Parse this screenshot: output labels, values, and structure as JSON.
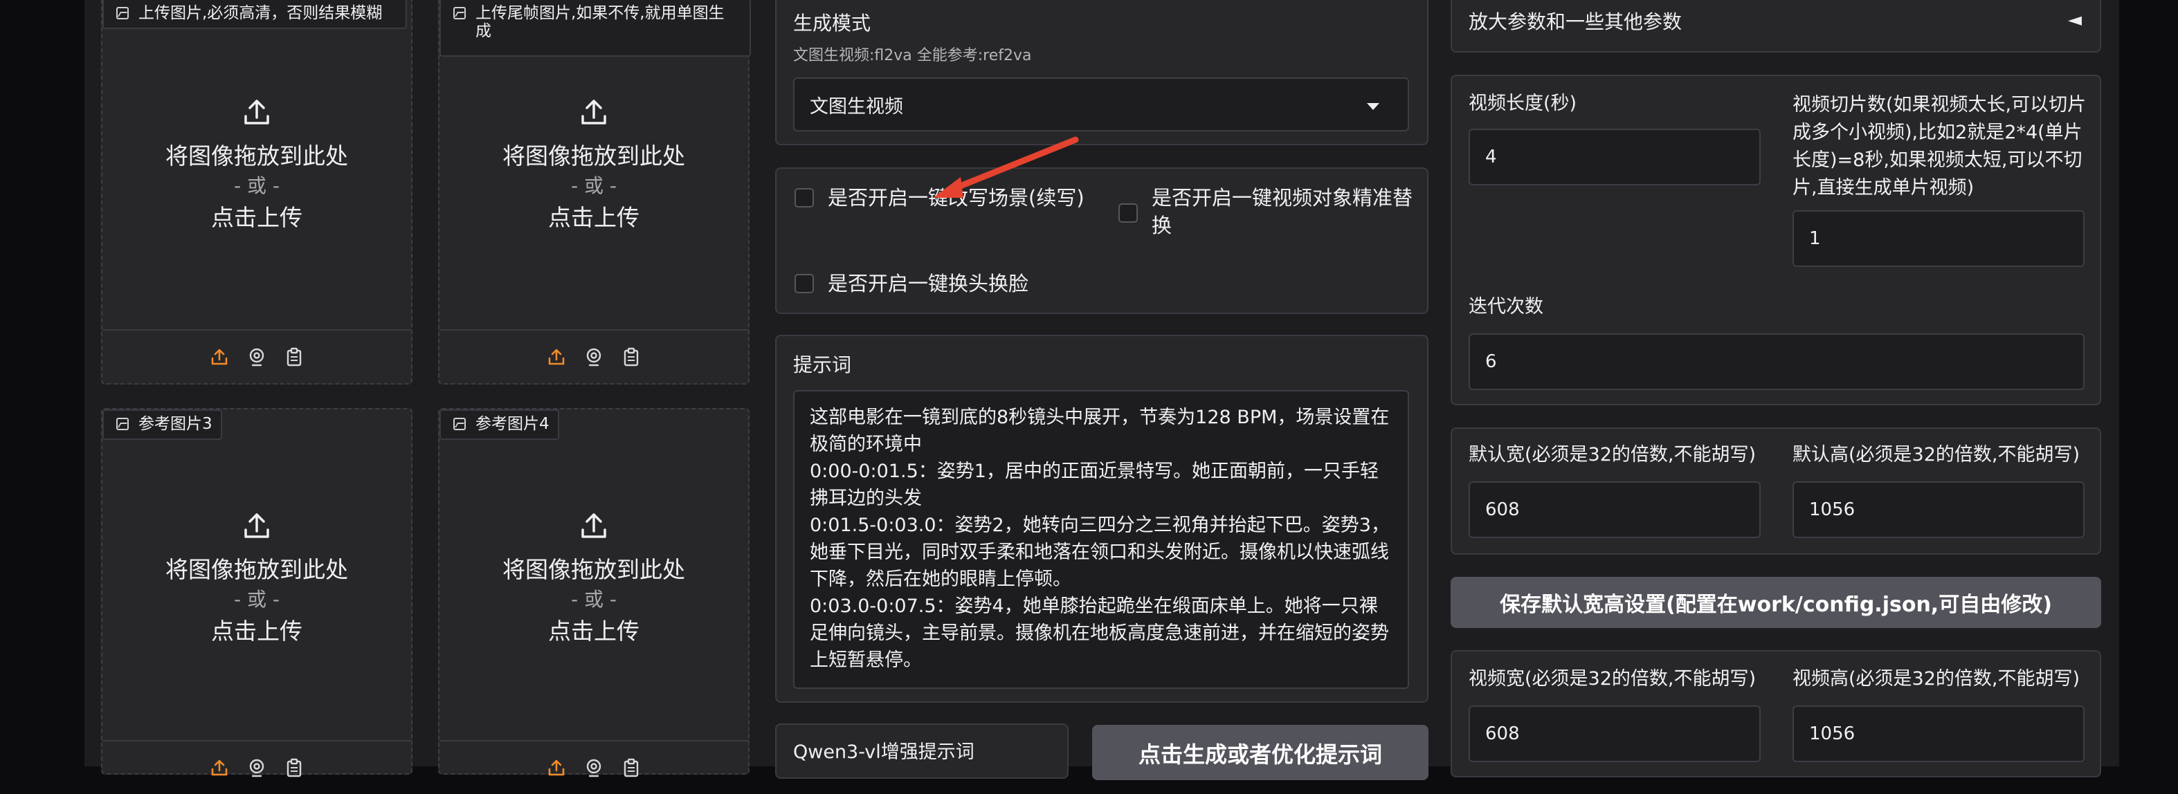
{
  "uploads": [
    {
      "tag": "上传图片,必须高清，否则结果模糊",
      "drop": "将图像拖放到此处",
      "or": "- 或 -",
      "click": "点击上传"
    },
    {
      "tag": "上传尾帧图片,如果不传,就用单图生\n成",
      "drop": "将图像拖放到此处",
      "or": "- 或 -",
      "click": "点击上传"
    },
    {
      "tag": "参考图片3",
      "drop": "将图像拖放到此处",
      "or": "- 或 -",
      "click": "点击上传"
    },
    {
      "tag": "参考图片4",
      "drop": "将图像拖放到此处",
      "or": "- 或 -",
      "click": "点击上传"
    }
  ],
  "gen_mode": {
    "label": "生成模式",
    "sublabel": "文图生视频:fl2va 全能参考:ref2va",
    "selected": "文图生视频"
  },
  "options": {
    "scene_continue": "是否开启一键改写场景(续写)",
    "object_replace": "是否开启一键视频对象精准替换",
    "face_swap": "是否开启一键换头换脸"
  },
  "prompt": {
    "label": "提示词",
    "value": "这部电影在一镜到底的8秒镜头中展开，节奏为128 BPM，场景设置在极简的环境中\n0:00-0:01.5：姿势1，居中的正面近景特写。她正面朝前，一只手轻拂耳边的头发\n0:01.5-0:03.0：姿势2，她转向三四分之三视角并抬起下巴。姿势3，她垂下目光，同时双手柔和地落在领口和头发附近。摄像机以快速弧线下降，然后在她的眼睛上停顿。\n0:03.0-0:07.5：姿势4，她单膝抬起跪坐在缎面床单上。她将一只裸足伸向镜头，主导前景。摄像机在地板高度急速前进，并在缩短的姿势上短暂悬停。"
  },
  "qwen": {
    "label": "Qwen3-vl增强提示词"
  },
  "generate_button": "点击生成或者优化提示词",
  "params": {
    "accordion_title": "放大参数和一些其他参数",
    "accordion_icon": "◄",
    "video_length_label": "视频长度(秒)",
    "video_length": "4",
    "slice_label": "视频切片数(如果视频太长,可以切片成多个小视频),比如2就是2*4(单片长度)=8秒,如果视频太短,可以不切片,直接生成单片视频)",
    "slice_value": "1",
    "iter_label": "迭代次数",
    "iter_value": "6",
    "default_w_label": "默认宽(必须是32的倍数,不能胡写)",
    "default_w": "608",
    "default_h_label": "默认高(必须是32的倍数,不能胡写)",
    "default_h": "1056",
    "save_button": "保存默认宽高设置(配置在work/config.json,可自由修改)",
    "video_w_label": "视频宽(必须是32的倍数,不能胡写)",
    "video_w": "608",
    "video_h_label": "视频高(必须是32的倍数,不能胡写)",
    "video_h": "1056"
  },
  "colors": {
    "accent": "#f28c28",
    "arrow": "#e5432f",
    "panel": "#27272a"
  }
}
